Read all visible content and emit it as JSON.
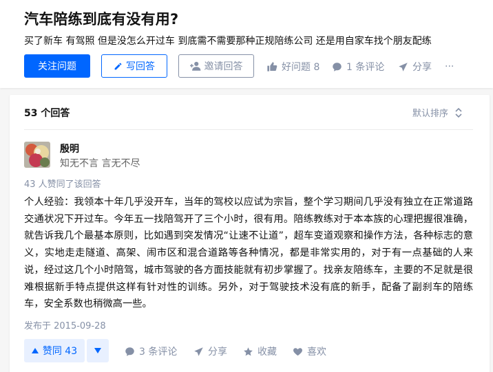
{
  "question": {
    "title": "汽车陪练到底有没有用?",
    "description": "买了新车 有驾照 但是没怎么开过车 到底需不需要那种正规陪练公司 还是用自家车找个朋友配练",
    "follow_label": "关注问题",
    "write_label": "写回答",
    "invite_label": "邀请回答",
    "good_question_label": "好问题 8",
    "comments_label": "1 条评论",
    "share_label": "分享",
    "more_label": "···"
  },
  "answers_section": {
    "count_label": "53 个回答",
    "sort_label": "默认排序"
  },
  "answer": {
    "author_name": "殷明",
    "author_bio": "知无不言 言无不尽",
    "votes_info": "43 人赞同了该回答",
    "body": "个人经验：我领本十年几乎没开车，当年的驾校以应试为宗旨，整个学习期间几乎没有独立在正常道路交通状况下开过车。今年五一找陪驾开了三个小时，很有用。陪练教练对于本本族的心理把握很准确，就告诉我几个最基本原则，比如遇到突发情况“让速不让道”，超车变道观察和操作方法，各种标志的意义，实地走走隧道、高架、闹市区和混合道路等各种情况，都是非常实用的，对于有一点基础的人来说，经过这几个小时陪驾，城市驾驶的各方面技能就有初步掌握了。找亲友陪练车，主要的不足就是很难根据新手特点提供这样有针对性的训练。另外，对于驾驶技术没有底的新手，配备了副刹车的陪练车，安全系数也稍微高一些。",
    "publish_date": "发布于 2015-09-28",
    "upvote_label": "赞同 43",
    "comments_label": "3 条评论",
    "share_label": "分享",
    "collect_label": "收藏",
    "like_label": "喜欢"
  },
  "colors": {
    "accent": "#0066ff",
    "muted": "#8590a6",
    "vote_bg": "#e8f0ff"
  },
  "icons": {
    "write": "pencil-icon",
    "invite": "add-user-icon",
    "good_question": "thumbs-up-icon",
    "comment": "comment-bubble-icon",
    "share": "paper-plane-icon",
    "sort": "sort-arrows-icon",
    "upvote": "triangle-up-icon",
    "downvote": "triangle-down-icon",
    "collect": "star-icon",
    "like": "heart-icon"
  }
}
